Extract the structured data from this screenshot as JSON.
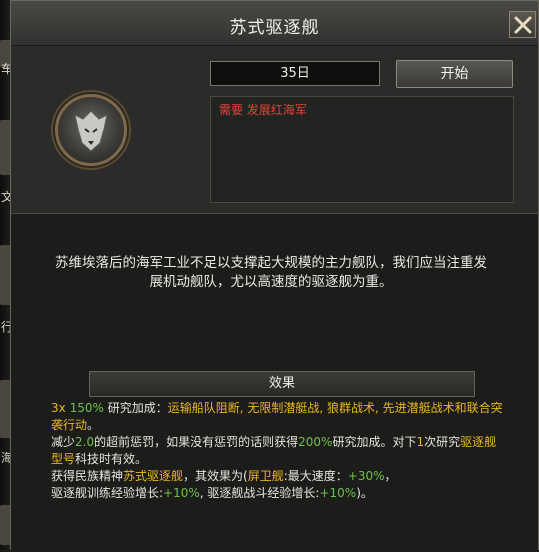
{
  "window": {
    "title": "苏式驱逐舰",
    "close_icon": "close-icon"
  },
  "research": {
    "days": "35日",
    "start_label": "开始",
    "requirement": "需要 发展红海军",
    "emblem_icon": "wolf-emblem-icon"
  },
  "description": "苏维埃落后的海军工业不足以支撑起大规模的主力舰队，我们应当注重发展机动舰队，尤以高速度的驱逐舰为重。",
  "effects": {
    "header": "效果",
    "line1_prefix": "3x",
    "line1_pct": "150%",
    "line1_label": "研究加成：",
    "line1_items": "运输船队阻断, 无限制潜艇战, 狼群战术, 先进潜艇战术和联合突袭行动",
    "line1_end": "。",
    "line2_a": "减少",
    "line2_num": "2.0",
    "line2_b": "的超前惩罚，如果没有惩罚的话则获得",
    "line2_pct": "200%",
    "line2_c": "研究加成。对下",
    "line2_count": "1",
    "line2_d": "次研究",
    "line2_tech": "驱逐舰型号",
    "line2_e": "科技时有效。",
    "line3_a": "获得民族精神",
    "line3_spirit": "苏式驱逐舰",
    "line3_b": "，其效果为(",
    "line3_ship": "屏卫舰",
    "line3_c": ":最大速度：",
    "line3_speed": "+30%",
    "line3_d": "，",
    "line4_a": "驱逐舰训练经验增长:",
    "line4_v1": "+10%",
    "line4_b": ", 驱逐舰战斗经验增长:",
    "line4_v2": "+10%",
    "line4_c": ")。"
  },
  "background": {
    "fragments": [
      "车",
      "文",
      "行",
      "海"
    ]
  }
}
